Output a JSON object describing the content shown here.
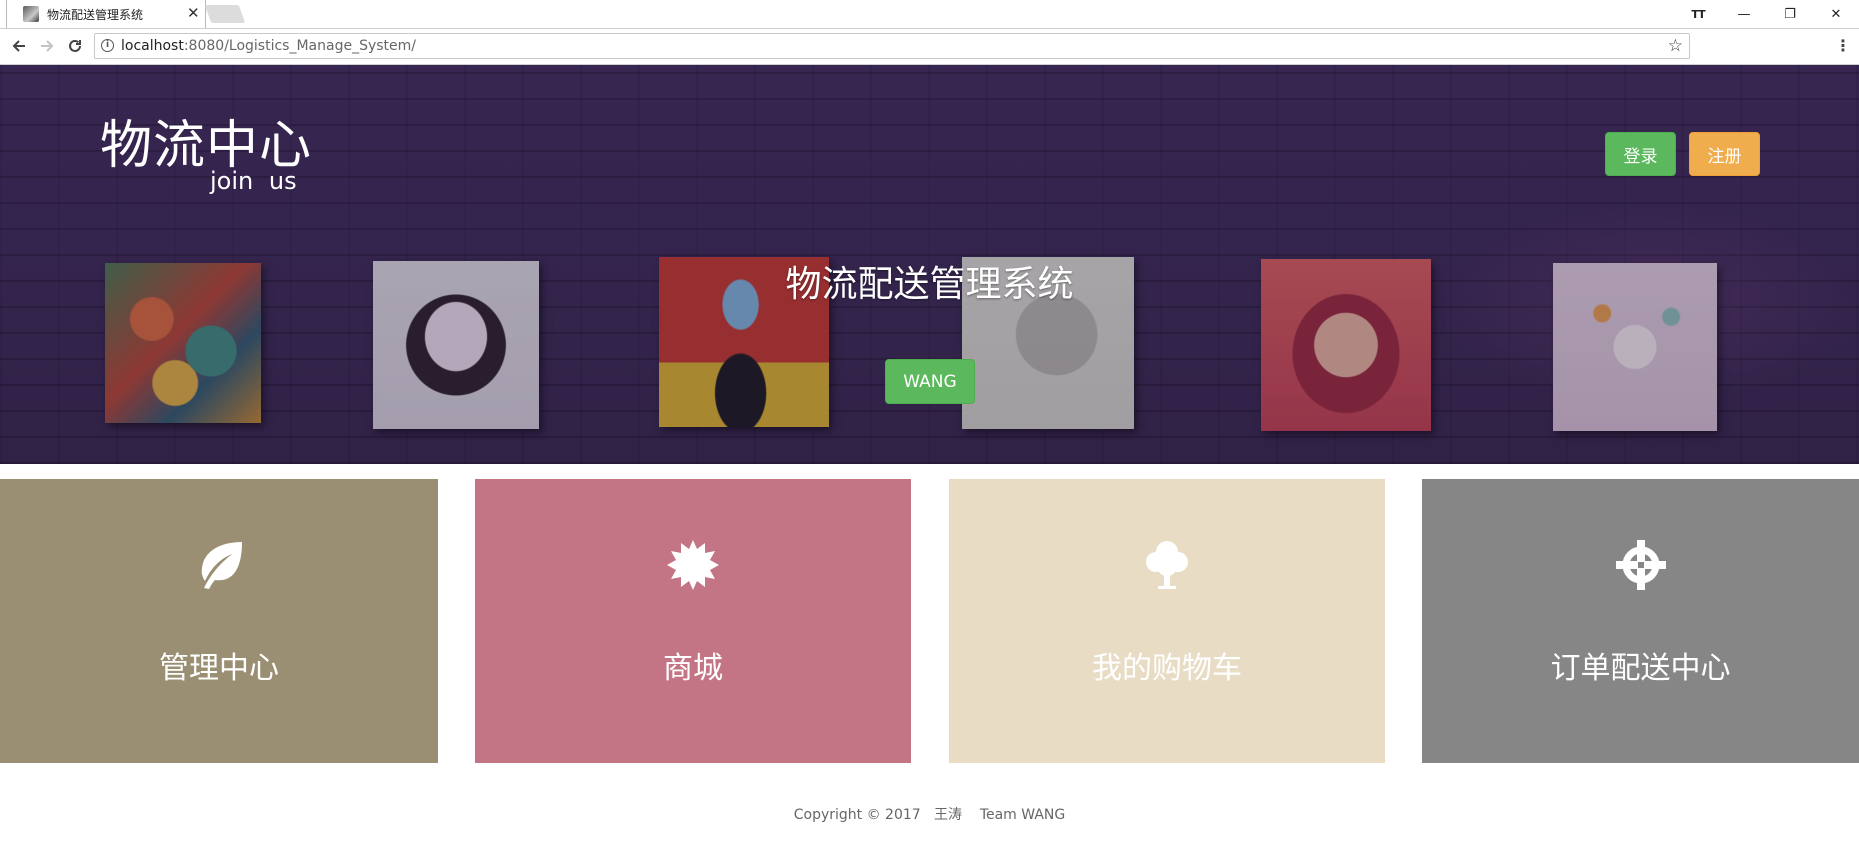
{
  "browser": {
    "tab_title": "物流配送管理系统",
    "close_glyph": "✕",
    "url_host": "localhost",
    "url_rest": ":8080/Logistics_Manage_System/",
    "controls": {
      "text_size": "TT",
      "minimize": "—",
      "restore": "❐",
      "close": "✕"
    }
  },
  "header": {
    "title": "物流中心",
    "subtitle": "join  us",
    "login_label": "登录",
    "register_label": "注册"
  },
  "hero": {
    "heading": "物流配送管理系统",
    "button_label": "WANG"
  },
  "tiles": [
    {
      "label": "管理中心",
      "icon": "leaf-icon",
      "color": "#9a8f72"
    },
    {
      "label": "商城",
      "icon": "certificate-icon",
      "color": "#c37585"
    },
    {
      "label": "我的购物车",
      "icon": "tree-icon",
      "color": "#e8dcc5"
    },
    {
      "label": "订单配送中心",
      "icon": "crosshair-icon",
      "color": "#868686"
    }
  ],
  "footer": {
    "copyright": "Copyright © 2017   王涛    Team WANG"
  },
  "colors": {
    "success": "#5cb85c",
    "warning": "#f0ad4e",
    "hero_bg": "#3a2b52"
  }
}
